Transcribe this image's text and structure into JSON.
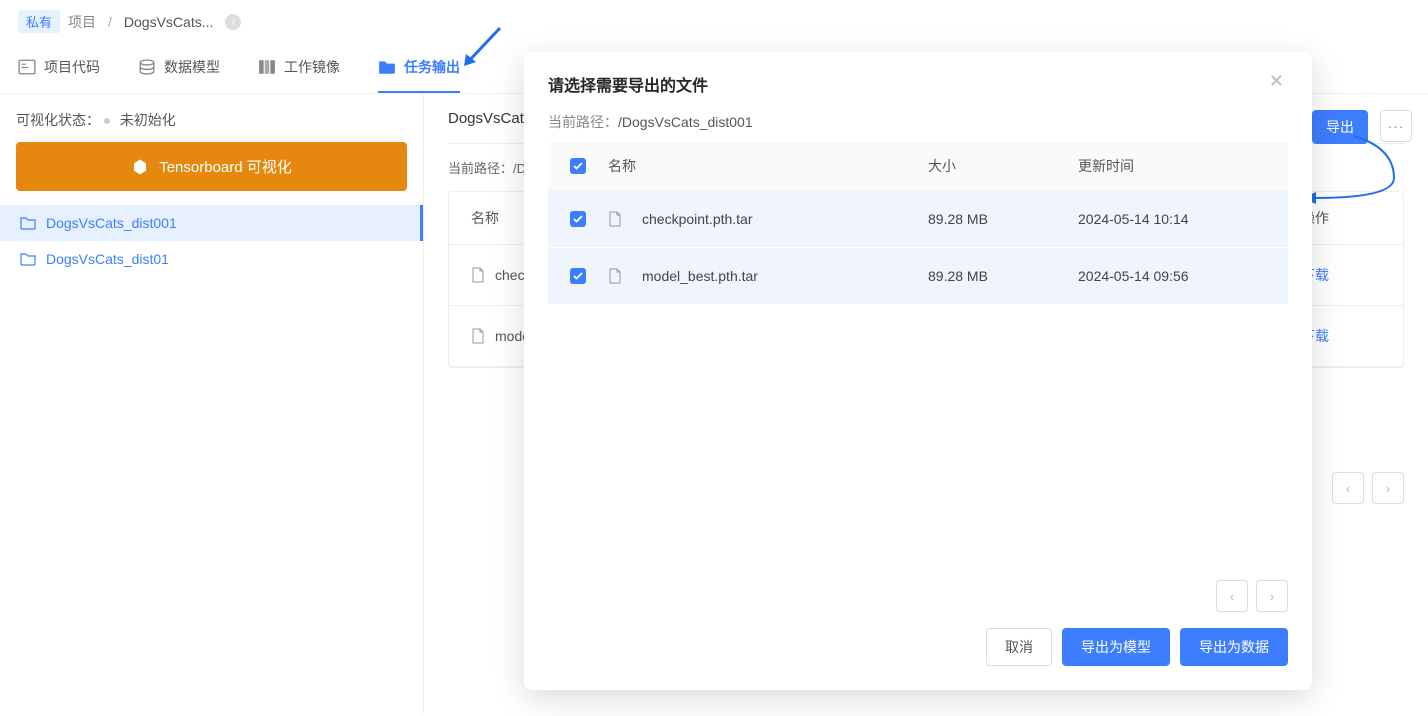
{
  "breadcrumb": {
    "privacy": "私有",
    "project": "项目",
    "name": "DogsVsCats..."
  },
  "tabs": [
    {
      "label": "项目代码",
      "icon": "code"
    },
    {
      "label": "数据模型",
      "icon": "data"
    },
    {
      "label": "工作镜像",
      "icon": "image"
    },
    {
      "label": "任务输出",
      "icon": "folder",
      "active": true
    }
  ],
  "sidebar": {
    "vis_label": "可视化状态：",
    "vis_status": "未初始化",
    "tensorboard_btn": "Tensorboard 可视化",
    "folders": [
      {
        "name": "DogsVsCats_dist001",
        "selected": true
      },
      {
        "name": "DogsVsCats_dist01",
        "selected": false
      }
    ]
  },
  "content": {
    "header_prefix": "DogsVsCat",
    "path_label": "当前路径：/D",
    "export_btn": "导出",
    "table": {
      "col_name": "名称",
      "col_op": "操作",
      "rows": [
        {
          "name": "check",
          "action": "下载"
        },
        {
          "name": "mode",
          "action": "下载"
        }
      ]
    }
  },
  "modal": {
    "title": "请选择需要导出的文件",
    "path_label": "当前路径：",
    "path_value": "/DogsVsCats_dist001",
    "columns": {
      "name": "名称",
      "size": "大小",
      "time": "更新时间"
    },
    "rows": [
      {
        "name": "checkpoint.pth.tar",
        "size": "89.28 MB",
        "time": "2024-05-14 10:14"
      },
      {
        "name": "model_best.pth.tar",
        "size": "89.28 MB",
        "time": "2024-05-14 09:56"
      }
    ],
    "footer": {
      "cancel": "取消",
      "export_model": "导出为模型",
      "export_data": "导出为数据"
    }
  }
}
